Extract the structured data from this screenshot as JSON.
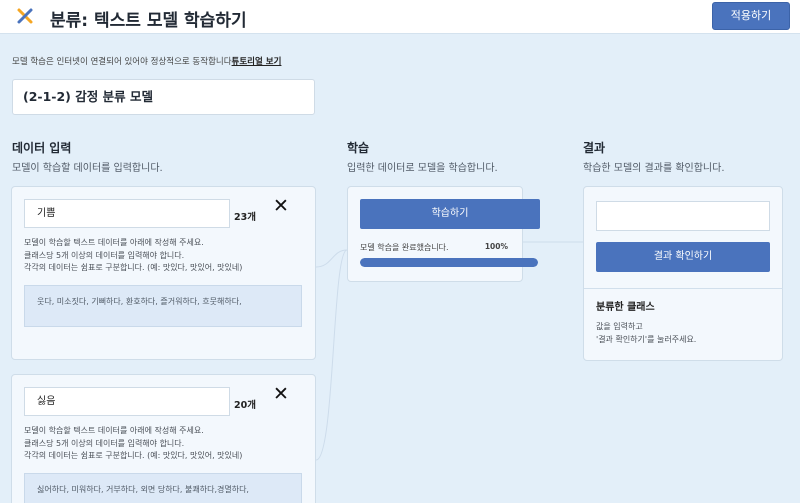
{
  "header": {
    "title": "분류: 텍스트 모델 학습하기",
    "apply_label": "적용하기",
    "logo_colors": [
      "#f5a623",
      "#4a73bd"
    ]
  },
  "notice": {
    "text": "모델 학습은 인터넷이 연결되어 있어야 정상적으로 동작합니다",
    "tutorial_link": "튜토리얼 보기"
  },
  "model_name": "(2-1-2) 감정 분류 모델",
  "input_section": {
    "title": "데이터 입력",
    "subtitle": "모델이 학습할 데이터를 입력합니다.",
    "classes": [
      {
        "name": "기쁨",
        "count": "23개",
        "instructions": [
          "모델이 학습할 텍스트 데이터를 아래에 작성해 주세요.",
          "클래스당 5개 이상의 데이터를 입력해야 합니다.",
          "각각의 데이터는 쉼표로 구분합니다. (예: 맛있다, 맛있어, 맛있네)"
        ],
        "samples": "웃다, 미소짓다, 기뻐하다, 환호하다, 즐거워하다, 흐뭇해하다,"
      },
      {
        "name": "싫음",
        "count": "20개",
        "instructions": [
          "모델이 학습할 텍스트 데이터를 아래에 작성해 주세요.",
          "클래스당 5개 이상의 데이터를 입력해야 합니다.",
          "각각의 데이터는 쉼표로 구분합니다. (예: 맛있다, 맛있어, 맛있네)"
        ],
        "samples": "싫어하다, 미워하다, 거부하다, 외면 당하다, 불쾌하다,경멸하다,"
      }
    ]
  },
  "train_section": {
    "title": "학습",
    "subtitle": "입력한 데이터로 모델을 학습합니다.",
    "button_label": "학습하기",
    "status": "모델 학습을 완료했습니다.",
    "progress_label": "100%",
    "progress": 1.0
  },
  "result_section": {
    "title": "결과",
    "subtitle": "학습한 모델의 결과를 확인합니다.",
    "input_value": "",
    "button_label": "결과 확인하기",
    "classified_title": "분류한 클래스",
    "hint": [
      "값을 입력하고",
      "'결과 확인하기'를 눌러주세요."
    ]
  }
}
